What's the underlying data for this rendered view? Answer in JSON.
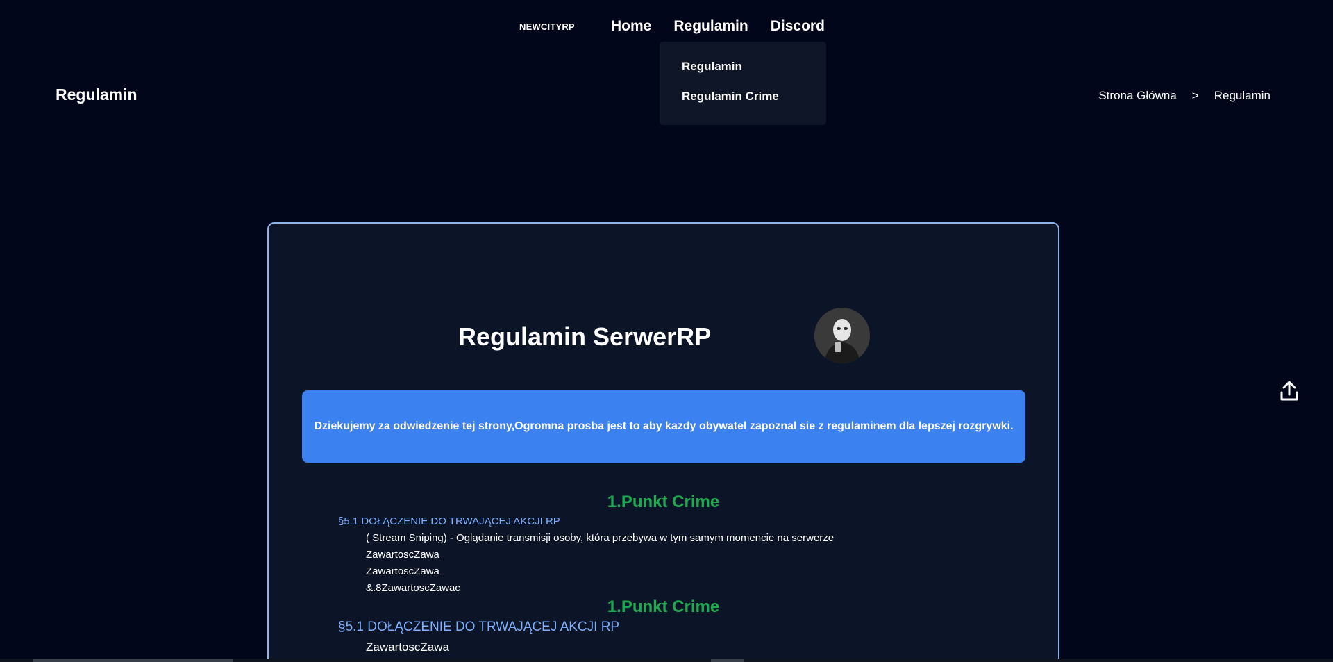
{
  "brand": "NEWCITYRP",
  "nav": {
    "home": "Home",
    "regulamin": "Regulamin",
    "discord": "Discord"
  },
  "dropdown": {
    "items": [
      "Regulamin",
      "Regulamin Crime"
    ]
  },
  "header": {
    "title": "Regulamin",
    "breadcrumb": {
      "home": "Strona Główna",
      "separator": ">",
      "current": "Regulamin"
    }
  },
  "card": {
    "title": "Regulamin SerwerRP",
    "notice": "Dziekujemy za odwiedzenie tej strony,Ogromna prosba jest to aby kazdy obywatel zapoznal sie z regulaminem dla lepszej rozgrywki.",
    "sections": [
      {
        "heading": "1.Punkt Crime",
        "sub": "§5.1 DOŁĄCZENIE DO TRWAJĄCEJ AKCJI RP",
        "lines": [
          "( Stream Sniping) - Oglądanie transmisji osoby, która przebywa w tym samym momencie na serwerze",
          "ZawartoscZawa",
          "ZawartoscZawa",
          "&.8ZawartoscZawac"
        ]
      },
      {
        "heading": "1.Punkt Crime",
        "sub": "§5.1 DOŁĄCZENIE DO TRWAJĄCEJ AKCJI RP",
        "lines": [
          "ZawartoscZawa"
        ]
      }
    ]
  },
  "icons": {
    "scroll_top": "upload-arrow-icon",
    "avatar": "avatar-image"
  },
  "colors": {
    "background": "#02061a",
    "card": "#0c1528",
    "card_border": "#8fb5e8",
    "notice": "#3b82f0",
    "section_heading": "#1faa4f",
    "subheading": "#7fb0ff"
  }
}
